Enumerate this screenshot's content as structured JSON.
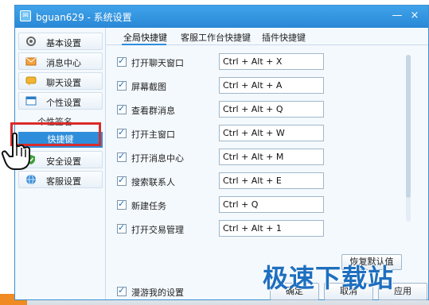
{
  "window": {
    "title": "bguan629 - 系统设置",
    "min_label": "—",
    "close_label": "×"
  },
  "sidebar": {
    "items": [
      {
        "label": "基本设置",
        "icon": "gear-icon"
      },
      {
        "label": "消息中心",
        "icon": "mail-icon"
      },
      {
        "label": "聊天设置",
        "icon": "chat-icon"
      },
      {
        "label": "个性设置",
        "icon": "personal-icon"
      },
      {
        "label": "安全设置",
        "icon": "shield-icon"
      },
      {
        "label": "客服设置",
        "icon": "globe-icon"
      }
    ],
    "sub_items": [
      {
        "label": "个性签名"
      },
      {
        "label": "快捷键",
        "selected": true
      }
    ]
  },
  "tabs": [
    {
      "label": "全局快捷键",
      "active": true
    },
    {
      "label": "客服工作台快捷键",
      "active": false
    },
    {
      "label": "插件快捷键",
      "active": false
    }
  ],
  "shortcuts": [
    {
      "label": "打开聊天窗口",
      "value": "Ctrl + Alt + X",
      "checked": true
    },
    {
      "label": "屏幕截图",
      "value": "Ctrl + Alt + A",
      "checked": true
    },
    {
      "label": "查看群消息",
      "value": "Ctrl + Alt + Q",
      "checked": true
    },
    {
      "label": "打开主窗口",
      "value": "Ctrl + Alt + W",
      "checked": true
    },
    {
      "label": "打开消息中心",
      "value": "Ctrl + Alt + M",
      "checked": true
    },
    {
      "label": "搜索联系人",
      "value": "Ctrl + Alt + E",
      "checked": true
    },
    {
      "label": "新建任务",
      "value": "Ctrl + Q",
      "checked": true
    },
    {
      "label": "打开交易管理",
      "value": "Ctrl + Alt + 1",
      "checked": true
    }
  ],
  "restore_label": "恢复默认值",
  "footer": {
    "roaming_label": "漫游我的设置",
    "roaming_checked": true,
    "ok_label": "确定",
    "cancel_label": "取消",
    "apply_label": "应用"
  },
  "watermark": "极速下载站",
  "colors": {
    "accent": "#2f8edb",
    "highlight_border": "#d92b2b",
    "titlebar": "#3fa3ea"
  }
}
